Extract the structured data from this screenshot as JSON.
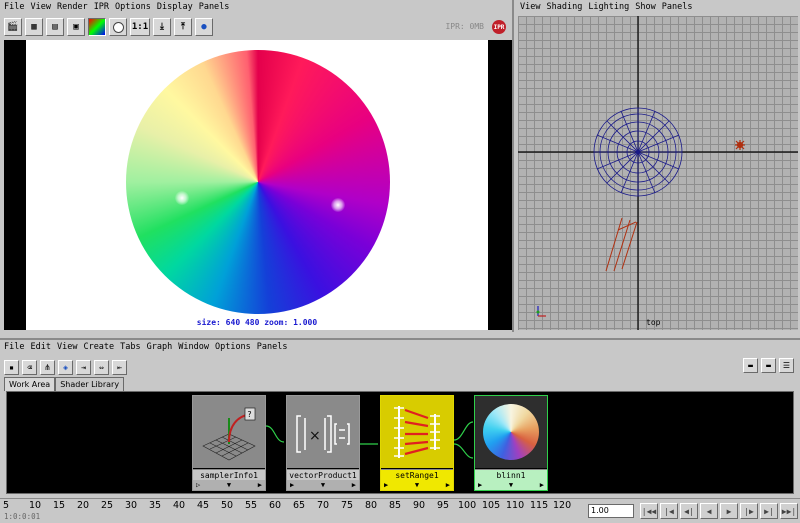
{
  "render_view": {
    "menu": [
      "File",
      "View",
      "Render",
      "IPR",
      "Options",
      "Display",
      "Panels"
    ],
    "toolbar": {
      "ratio_label": "1:1",
      "ipr_status": "IPR: 0MB",
      "ipr_badge": "IPR"
    },
    "status": "size:  640  480 zoom: 1.000"
  },
  "ortho_view": {
    "menu": [
      "View",
      "Shading",
      "Lighting",
      "Show",
      "Panels"
    ],
    "camera_label": "top",
    "colors": {
      "wireframe": "#1a1a8a",
      "light": "#b03010",
      "axis": "#000000"
    }
  },
  "hypershade": {
    "menu": [
      "File",
      "Edit",
      "View",
      "Create",
      "Tabs",
      "Graph",
      "Window",
      "Options",
      "Panels"
    ],
    "tabs": [
      {
        "label": "Work Area",
        "active": true
      },
      {
        "label": "Shader Library",
        "active": false
      }
    ],
    "nodes": [
      {
        "name": "samplerInfo1",
        "left_port": "▷",
        "mid_port": "▼",
        "right_port": "▶"
      },
      {
        "name": "vectorProduct1",
        "left_port": "▶",
        "mid_port": "▼",
        "right_port": "▶"
      },
      {
        "name": "setRange1",
        "left_port": "▶",
        "mid_port": "▼",
        "right_port": "▶"
      },
      {
        "name": "blinn1",
        "left_port": "▶",
        "mid_port": "▼",
        "right_port": "▶"
      }
    ],
    "colors": {
      "setRange": "#f0e800",
      "blinn": "#2fd04a",
      "connection": "#2fd04a"
    }
  },
  "timeline": {
    "ticks": [
      "5",
      "10",
      "15",
      "20",
      "25",
      "30",
      "35",
      "40",
      "45",
      "50",
      "55",
      "60",
      "65",
      "70",
      "75",
      "80",
      "85",
      "90",
      "95",
      "100",
      "105",
      "110",
      "115",
      "120"
    ],
    "current_frame_readout": "1:0:0:01",
    "current_time": "1.00",
    "playback_buttons": [
      "|◀◀",
      "|◀",
      "◀|",
      "◀",
      "▶",
      "|▶",
      "▶|",
      "▶▶|"
    ]
  }
}
